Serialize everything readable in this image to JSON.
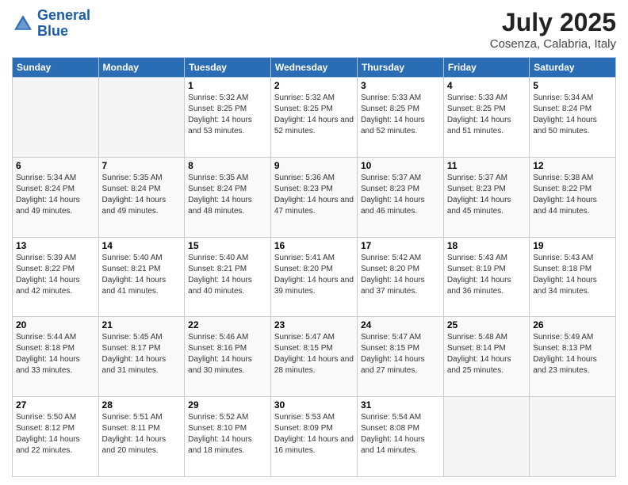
{
  "header": {
    "logo_line1": "General",
    "logo_line2": "Blue",
    "month": "July 2025",
    "location": "Cosenza, Calabria, Italy"
  },
  "days_of_week": [
    "Sunday",
    "Monday",
    "Tuesday",
    "Wednesday",
    "Thursday",
    "Friday",
    "Saturday"
  ],
  "weeks": [
    [
      {
        "day": "",
        "sunrise": "",
        "sunset": "",
        "daylight": ""
      },
      {
        "day": "",
        "sunrise": "",
        "sunset": "",
        "daylight": ""
      },
      {
        "day": "1",
        "sunrise": "Sunrise: 5:32 AM",
        "sunset": "Sunset: 8:25 PM",
        "daylight": "Daylight: 14 hours and 53 minutes."
      },
      {
        "day": "2",
        "sunrise": "Sunrise: 5:32 AM",
        "sunset": "Sunset: 8:25 PM",
        "daylight": "Daylight: 14 hours and 52 minutes."
      },
      {
        "day": "3",
        "sunrise": "Sunrise: 5:33 AM",
        "sunset": "Sunset: 8:25 PM",
        "daylight": "Daylight: 14 hours and 52 minutes."
      },
      {
        "day": "4",
        "sunrise": "Sunrise: 5:33 AM",
        "sunset": "Sunset: 8:25 PM",
        "daylight": "Daylight: 14 hours and 51 minutes."
      },
      {
        "day": "5",
        "sunrise": "Sunrise: 5:34 AM",
        "sunset": "Sunset: 8:24 PM",
        "daylight": "Daylight: 14 hours and 50 minutes."
      }
    ],
    [
      {
        "day": "6",
        "sunrise": "Sunrise: 5:34 AM",
        "sunset": "Sunset: 8:24 PM",
        "daylight": "Daylight: 14 hours and 49 minutes."
      },
      {
        "day": "7",
        "sunrise": "Sunrise: 5:35 AM",
        "sunset": "Sunset: 8:24 PM",
        "daylight": "Daylight: 14 hours and 49 minutes."
      },
      {
        "day": "8",
        "sunrise": "Sunrise: 5:35 AM",
        "sunset": "Sunset: 8:24 PM",
        "daylight": "Daylight: 14 hours and 48 minutes."
      },
      {
        "day": "9",
        "sunrise": "Sunrise: 5:36 AM",
        "sunset": "Sunset: 8:23 PM",
        "daylight": "Daylight: 14 hours and 47 minutes."
      },
      {
        "day": "10",
        "sunrise": "Sunrise: 5:37 AM",
        "sunset": "Sunset: 8:23 PM",
        "daylight": "Daylight: 14 hours and 46 minutes."
      },
      {
        "day": "11",
        "sunrise": "Sunrise: 5:37 AM",
        "sunset": "Sunset: 8:23 PM",
        "daylight": "Daylight: 14 hours and 45 minutes."
      },
      {
        "day": "12",
        "sunrise": "Sunrise: 5:38 AM",
        "sunset": "Sunset: 8:22 PM",
        "daylight": "Daylight: 14 hours and 44 minutes."
      }
    ],
    [
      {
        "day": "13",
        "sunrise": "Sunrise: 5:39 AM",
        "sunset": "Sunset: 8:22 PM",
        "daylight": "Daylight: 14 hours and 42 minutes."
      },
      {
        "day": "14",
        "sunrise": "Sunrise: 5:40 AM",
        "sunset": "Sunset: 8:21 PM",
        "daylight": "Daylight: 14 hours and 41 minutes."
      },
      {
        "day": "15",
        "sunrise": "Sunrise: 5:40 AM",
        "sunset": "Sunset: 8:21 PM",
        "daylight": "Daylight: 14 hours and 40 minutes."
      },
      {
        "day": "16",
        "sunrise": "Sunrise: 5:41 AM",
        "sunset": "Sunset: 8:20 PM",
        "daylight": "Daylight: 14 hours and 39 minutes."
      },
      {
        "day": "17",
        "sunrise": "Sunrise: 5:42 AM",
        "sunset": "Sunset: 8:20 PM",
        "daylight": "Daylight: 14 hours and 37 minutes."
      },
      {
        "day": "18",
        "sunrise": "Sunrise: 5:43 AM",
        "sunset": "Sunset: 8:19 PM",
        "daylight": "Daylight: 14 hours and 36 minutes."
      },
      {
        "day": "19",
        "sunrise": "Sunrise: 5:43 AM",
        "sunset": "Sunset: 8:18 PM",
        "daylight": "Daylight: 14 hours and 34 minutes."
      }
    ],
    [
      {
        "day": "20",
        "sunrise": "Sunrise: 5:44 AM",
        "sunset": "Sunset: 8:18 PM",
        "daylight": "Daylight: 14 hours and 33 minutes."
      },
      {
        "day": "21",
        "sunrise": "Sunrise: 5:45 AM",
        "sunset": "Sunset: 8:17 PM",
        "daylight": "Daylight: 14 hours and 31 minutes."
      },
      {
        "day": "22",
        "sunrise": "Sunrise: 5:46 AM",
        "sunset": "Sunset: 8:16 PM",
        "daylight": "Daylight: 14 hours and 30 minutes."
      },
      {
        "day": "23",
        "sunrise": "Sunrise: 5:47 AM",
        "sunset": "Sunset: 8:15 PM",
        "daylight": "Daylight: 14 hours and 28 minutes."
      },
      {
        "day": "24",
        "sunrise": "Sunrise: 5:47 AM",
        "sunset": "Sunset: 8:15 PM",
        "daylight": "Daylight: 14 hours and 27 minutes."
      },
      {
        "day": "25",
        "sunrise": "Sunrise: 5:48 AM",
        "sunset": "Sunset: 8:14 PM",
        "daylight": "Daylight: 14 hours and 25 minutes."
      },
      {
        "day": "26",
        "sunrise": "Sunrise: 5:49 AM",
        "sunset": "Sunset: 8:13 PM",
        "daylight": "Daylight: 14 hours and 23 minutes."
      }
    ],
    [
      {
        "day": "27",
        "sunrise": "Sunrise: 5:50 AM",
        "sunset": "Sunset: 8:12 PM",
        "daylight": "Daylight: 14 hours and 22 minutes."
      },
      {
        "day": "28",
        "sunrise": "Sunrise: 5:51 AM",
        "sunset": "Sunset: 8:11 PM",
        "daylight": "Daylight: 14 hours and 20 minutes."
      },
      {
        "day": "29",
        "sunrise": "Sunrise: 5:52 AM",
        "sunset": "Sunset: 8:10 PM",
        "daylight": "Daylight: 14 hours and 18 minutes."
      },
      {
        "day": "30",
        "sunrise": "Sunrise: 5:53 AM",
        "sunset": "Sunset: 8:09 PM",
        "daylight": "Daylight: 14 hours and 16 minutes."
      },
      {
        "day": "31",
        "sunrise": "Sunrise: 5:54 AM",
        "sunset": "Sunset: 8:08 PM",
        "daylight": "Daylight: 14 hours and 14 minutes."
      },
      {
        "day": "",
        "sunrise": "",
        "sunset": "",
        "daylight": ""
      },
      {
        "day": "",
        "sunrise": "",
        "sunset": "",
        "daylight": ""
      }
    ]
  ]
}
